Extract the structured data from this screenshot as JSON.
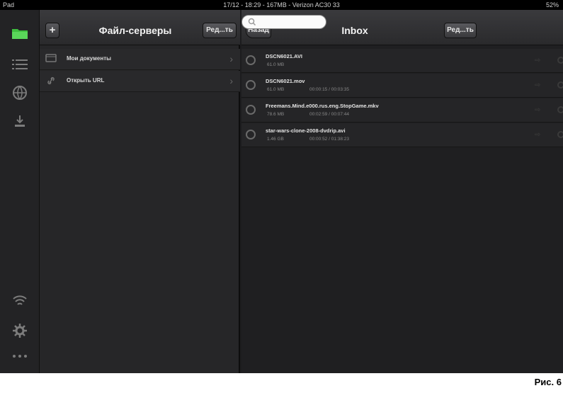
{
  "status_bar": {
    "left": "Pad",
    "center": "17/12 - 18:29 - 167MB - Verizon AC30 33",
    "right": "52%"
  },
  "rail": {
    "icons": [
      "folder-icon",
      "list-icon",
      "globe-icon",
      "download-icon",
      "wifi-icon",
      "gear-icon",
      "more-icon"
    ]
  },
  "servers": {
    "add_label": "+",
    "title": "Файл-серверы",
    "edit_label": "Ред...ть",
    "items": [
      {
        "label": "Мои документы"
      },
      {
        "label": "Открыть URL"
      }
    ]
  },
  "inbox": {
    "back_label": "Назад",
    "title": "Inbox",
    "edit_label": "Ред...ть",
    "search": {
      "placeholder": ""
    },
    "files": [
      {
        "name": "DSCN6021.AVI",
        "size": "61.0 MB",
        "duration": ""
      },
      {
        "name": "DSCN6021.mov",
        "size": "61.0 MB",
        "duration": "00:00:15 / 00:03:35"
      },
      {
        "name": "Freemans.Mind.e000.rus.eng.StopGame.mkv",
        "size": "78.6 MB",
        "duration": "00:02:59 / 00:07:44"
      },
      {
        "name": "star-wars-clone-2008-dvdrip.avi",
        "size": "1.46 GB",
        "duration": "00:00:52 / 01:38:23"
      }
    ]
  },
  "caption": "Рис. 6",
  "colors": {
    "accent": "#3fbf3f",
    "panel": "#262628",
    "background": "#1c1c1e"
  }
}
